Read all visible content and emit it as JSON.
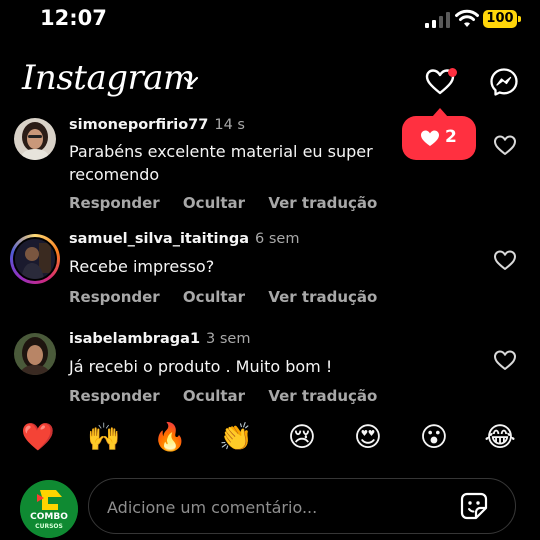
{
  "status": {
    "time": "12:07",
    "battery": "100"
  },
  "header": {
    "logo": "Instagram",
    "likes_count": "2"
  },
  "comments": [
    {
      "username": "simoneporfirio77",
      "time": "14 s",
      "text": "Parabéns excelente material eu super recomendo"
    },
    {
      "username": "samuel_silva_itaitinga",
      "time": "6 sem",
      "text": "Recebe impresso?"
    },
    {
      "username": "isabelambraga1",
      "time": "3 sem",
      "text": "Já recebi o produto . Muito bom !"
    }
  ],
  "actions": {
    "reply": "Responder",
    "hide": "Ocultar",
    "translate": "Ver tradução"
  },
  "reactions": [
    "❤️",
    "🙌",
    "🔥",
    "👏",
    "😢",
    "😍",
    "😮",
    "😂"
  ],
  "composer": {
    "placeholder": "Adicione um comentário...",
    "avatar_text_1": "COMBO",
    "avatar_text_2": "CURSOS"
  },
  "colors": {
    "background": "#000000",
    "notification": "#ff3040",
    "battery": "#ffd60a"
  },
  "icons": [
    "signal-icon",
    "wifi-icon",
    "chevron-down-icon",
    "heart-icon",
    "messenger-icon",
    "sticker-icon"
  ]
}
